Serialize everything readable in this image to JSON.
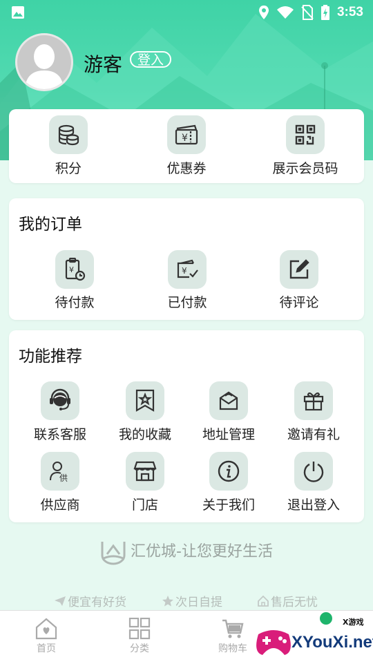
{
  "status_bar": {
    "time": "3:53",
    "icons": [
      "image-icon",
      "location-icon",
      "wifi-icon",
      "no-sim-icon",
      "battery-charging-icon"
    ]
  },
  "profile": {
    "name": "游客",
    "login_label": "登入"
  },
  "quick_actions": [
    {
      "label": "积分",
      "icon": "coins-icon"
    },
    {
      "label": "优惠券",
      "icon": "coupon-icon"
    },
    {
      "label": "展示会员码",
      "icon": "qrcode-icon"
    }
  ],
  "orders": {
    "title": "我的订单",
    "items": [
      {
        "label": "待付款",
        "icon": "pending-payment-icon"
      },
      {
        "label": "已付款",
        "icon": "paid-icon"
      },
      {
        "label": "待评论",
        "icon": "edit-review-icon"
      }
    ]
  },
  "features": {
    "title": "功能推荐",
    "items": [
      {
        "label": "联系客服",
        "icon": "headset-icon"
      },
      {
        "label": "我的收藏",
        "icon": "bookmark-star-icon"
      },
      {
        "label": "地址管理",
        "icon": "address-box-icon"
      },
      {
        "label": "邀请有礼",
        "icon": "gift-icon"
      },
      {
        "label": "供应商",
        "icon": "supplier-icon"
      },
      {
        "label": "门店",
        "icon": "store-icon"
      },
      {
        "label": "关于我们",
        "icon": "info-icon"
      },
      {
        "label": "退出登入",
        "icon": "power-icon"
      }
    ]
  },
  "slogan": "汇优城-让您更好生活",
  "promises": [
    {
      "label": "便宜有好货",
      "icon": "paper-plane-icon"
    },
    {
      "label": "次日自提",
      "icon": "star-icon"
    },
    {
      "label": "售后无忧",
      "icon": "home-outline-icon"
    }
  ],
  "tabs": [
    {
      "label": "首页",
      "icon": "home-heart-icon"
    },
    {
      "label": "分类",
      "icon": "grid-icon"
    },
    {
      "label": "购物车",
      "icon": "cart-icon"
    }
  ],
  "watermark": {
    "text": "XYouXi.net",
    "small": "X游戏"
  },
  "colors": {
    "primary": "#4fd6ac",
    "icon_bg": "#dbe8e3",
    "page_bg": "#e6f9f1"
  }
}
